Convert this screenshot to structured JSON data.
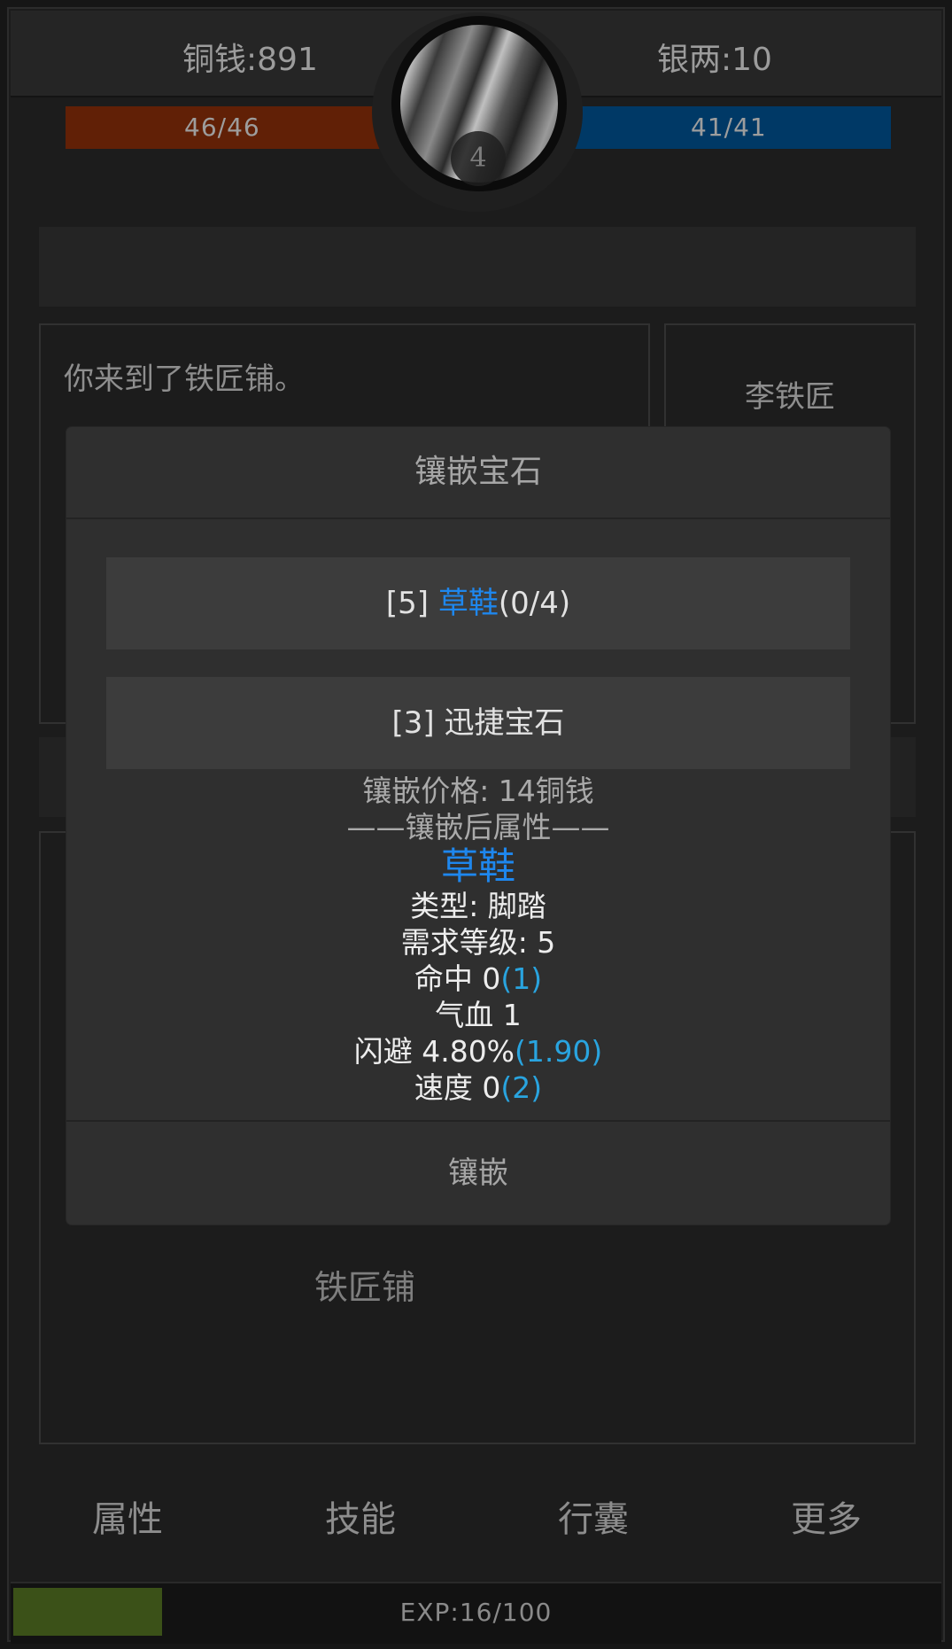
{
  "header": {
    "copper": "铜钱:891",
    "silver": "银两:10",
    "hp": "46/46",
    "mp": "41/41",
    "level": "4"
  },
  "message": "你来到了铁匠铺。",
  "npc": "李铁匠",
  "location": "铁匠铺",
  "nav": [
    "属性",
    "技能",
    "行囊",
    "更多"
  ],
  "exp": {
    "label": "EXP:16/100",
    "fill_fraction": 0.16
  },
  "modal": {
    "title": "镶嵌宝石",
    "item_slot": {
      "prefix": "[5] ",
      "name": "草鞋",
      "suffix": "(0/4)"
    },
    "gem_slot": "[3] 迅捷宝石",
    "price": "镶嵌价格: 14铜钱",
    "after_header": "——镶嵌后属性——",
    "item_name": "草鞋",
    "type": "类型: 脚踏",
    "req_level": "需求等级: 5",
    "stats": [
      {
        "label": "命中  0",
        "bonus": "(1)"
      },
      {
        "label": "气血  1",
        "bonus": ""
      },
      {
        "label": "闪避  4.80%",
        "bonus": "(1.90)"
      },
      {
        "label": "速度  0",
        "bonus": "(2)"
      }
    ],
    "button": "镶嵌"
  },
  "colors": {
    "hp_bar": "#612006",
    "mp_bar": "#003966",
    "exp_fill": "#3b5118",
    "item_name": "#1e87ee",
    "stat_bonus": "#29a4df"
  }
}
